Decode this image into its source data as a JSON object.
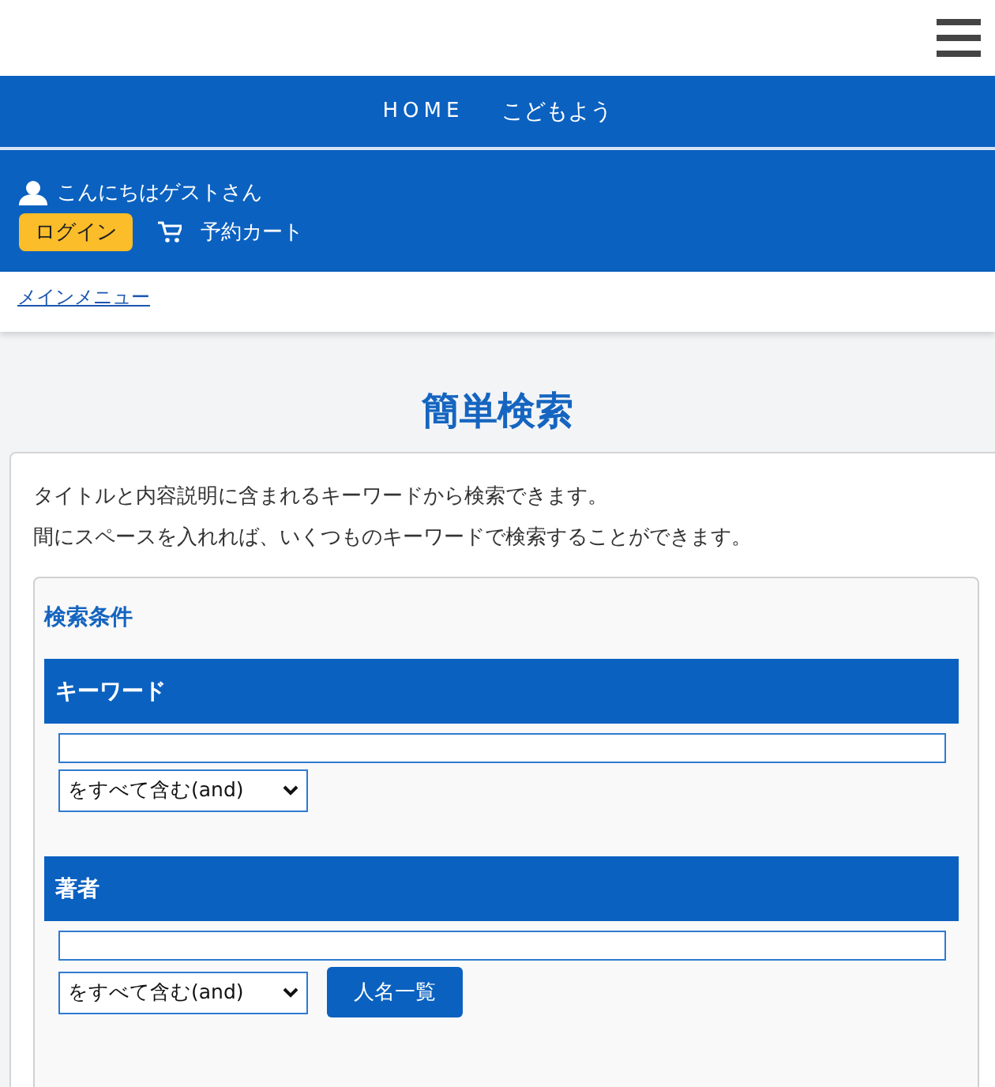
{
  "nav": {
    "items": [
      "HOME",
      "こどもよう"
    ]
  },
  "user_bar": {
    "greeting": "こんにちはゲストさん",
    "login_button": "ログイン",
    "cart_link": "予約カート"
  },
  "breadcrumb": {
    "link": "メインメニュー"
  },
  "page_title": "簡単検索",
  "intro": [
    "タイトルと内容説明に含まれるキーワードから検索できます。",
    "間にスペースを入れれば、いくつものキーワードで検索することができます。"
  ],
  "conditions": {
    "title": "検索条件",
    "sections": [
      {
        "label": "キーワード",
        "mode": "をすべて含む(and)"
      },
      {
        "label": "著者",
        "mode": "をすべて含む(and)",
        "button": "人名一覧"
      }
    ]
  }
}
